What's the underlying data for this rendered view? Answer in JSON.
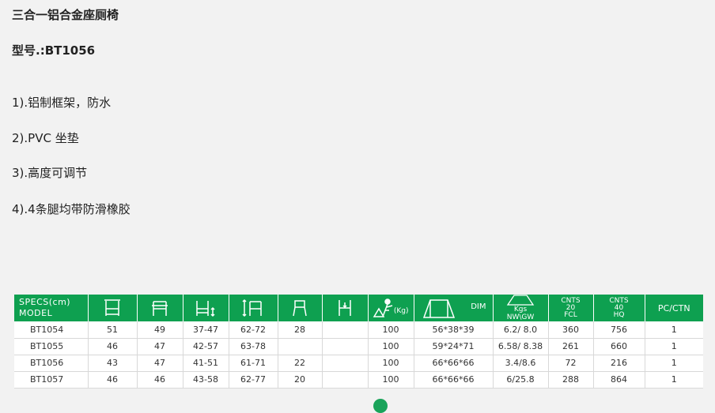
{
  "product": {
    "title": "三合一铝合金座厕椅",
    "model_label": "型号.:BT1056"
  },
  "features": [
    "1).铝制框架，防水",
    "2).PVC 坐垫",
    "3).高度可调节",
    "4).4条腿均带防滑橡胶"
  ],
  "table": {
    "header": {
      "specs": "SPECS(cm)",
      "model": "MODEL",
      "weight_unit": "(Kg)",
      "dim": "DIM",
      "kgs": "Kgs",
      "nwgw": "NW\\GW",
      "cnts20_1": "CNTS",
      "cnts20_2": "20",
      "cnts20_3": "FCL",
      "cnts40_1": "CNTS",
      "cnts40_2": "40",
      "cnts40_3": "HQ",
      "pcctn": "PC/CTN"
    },
    "rows": [
      {
        "model": "BT1054",
        "c1": "51",
        "c2": "49",
        "c3": "37-47",
        "c4": "62-72",
        "c5": "28",
        "c6": "",
        "weight": "100",
        "dim": "56*38*39",
        "nwgw": "6.2/ 8.0",
        "fcl": "360",
        "hq": "756",
        "pc": "1"
      },
      {
        "model": "BT1055",
        "c1": "46",
        "c2": "47",
        "c3": "42-57",
        "c4": "63-78",
        "c5": "",
        "c6": "",
        "weight": "100",
        "dim": "59*24*71",
        "nwgw": "6.58/ 8.38",
        "fcl": "261",
        "hq": "660",
        "pc": "1"
      },
      {
        "model": "BT1056",
        "c1": "43",
        "c2": "47",
        "c3": "41-51",
        "c4": "61-71",
        "c5": "22",
        "c6": "",
        "weight": "100",
        "dim": "66*66*66",
        "nwgw": "3.4/8.6",
        "fcl": "72",
        "hq": "216",
        "pc": "1"
      },
      {
        "model": "BT1057",
        "c1": "46",
        "c2": "46",
        "c3": "43-58",
        "c4": "62-77",
        "c5": "20",
        "c6": "",
        "weight": "100",
        "dim": "66*66*66",
        "nwgw": "6/25.8",
        "fcl": "288",
        "hq": "864",
        "pc": "1"
      }
    ]
  },
  "icons": {
    "width": "chair-width-icon",
    "depth": "chair-depth-icon",
    "seat_height": "seat-height-icon",
    "overall_height": "overall-height-icon",
    "seat": "seat-icon",
    "frame": "frame-icon",
    "weight": "weight-capacity-icon",
    "box": "box-dimension-icon",
    "weight_scale": "weight-scale-icon"
  },
  "colors": {
    "header_green": "#0ea050",
    "background": "#f2f2f2"
  }
}
